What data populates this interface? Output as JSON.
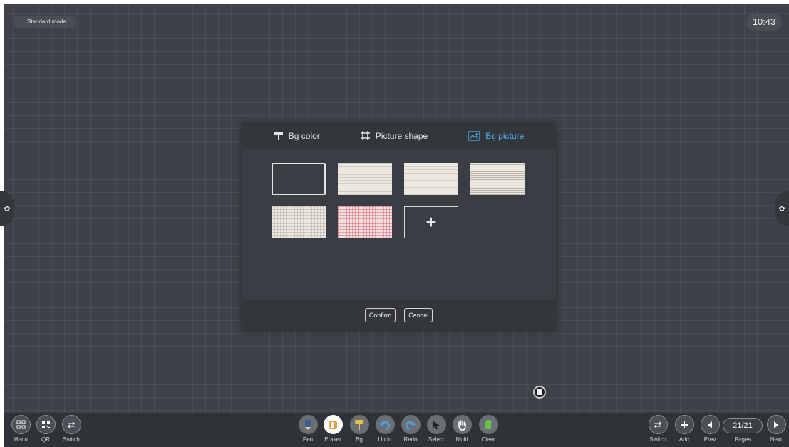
{
  "mode_label": "Standard mode",
  "clock": "10:43",
  "dialog": {
    "tabs": [
      {
        "label": "Bg color",
        "icon": "paint-roller-icon",
        "active": false
      },
      {
        "label": "Picture shape",
        "icon": "crop-icon",
        "active": false
      },
      {
        "label": "Bg picture",
        "icon": "image-icon",
        "active": true
      }
    ],
    "thumbnails": [
      "blank",
      "lined",
      "lined-wide",
      "lined-dense",
      "grid",
      "pink-grid",
      "add"
    ],
    "add_symbol": "+",
    "confirm_label": "Confirm",
    "cancel_label": "Cancel"
  },
  "toolbar": {
    "left": [
      {
        "label": "Menu",
        "icon": "menu-grid-icon"
      },
      {
        "label": "QR",
        "icon": "qr-code-icon"
      },
      {
        "label": "Switch",
        "icon": "switch-icon"
      }
    ],
    "center": [
      {
        "label": "Pen",
        "icon": "pen-icon"
      },
      {
        "label": "Eraser",
        "icon": "eraser-icon"
      },
      {
        "label": "Bg",
        "icon": "paint-roller-icon"
      },
      {
        "label": "Undo",
        "icon": "undo-icon"
      },
      {
        "label": "Redo",
        "icon": "redo-icon"
      },
      {
        "label": "Select",
        "icon": "cursor-icon"
      },
      {
        "label": "Multi",
        "icon": "hand-icon"
      },
      {
        "label": "Clear",
        "icon": "trash-icon"
      }
    ],
    "right": [
      {
        "label": "Switch",
        "icon": "switch-icon"
      },
      {
        "label": "Add",
        "icon": "plus-icon"
      },
      {
        "label": "Prev",
        "icon": "prev-icon"
      },
      {
        "label": "Pages",
        "icon": ""
      },
      {
        "label": "Next",
        "icon": "next-icon"
      }
    ],
    "page_counter": "21/21"
  },
  "colors": {
    "accent": "#4fb3ea",
    "background": "#3e4147",
    "eraser_icon": "#e0a040",
    "bg_icon": "#e6c04a",
    "undo_redo_icon": "#4d9fd6",
    "clear_icon": "#6abf4b",
    "pen_icon": "#3a5a9a"
  }
}
